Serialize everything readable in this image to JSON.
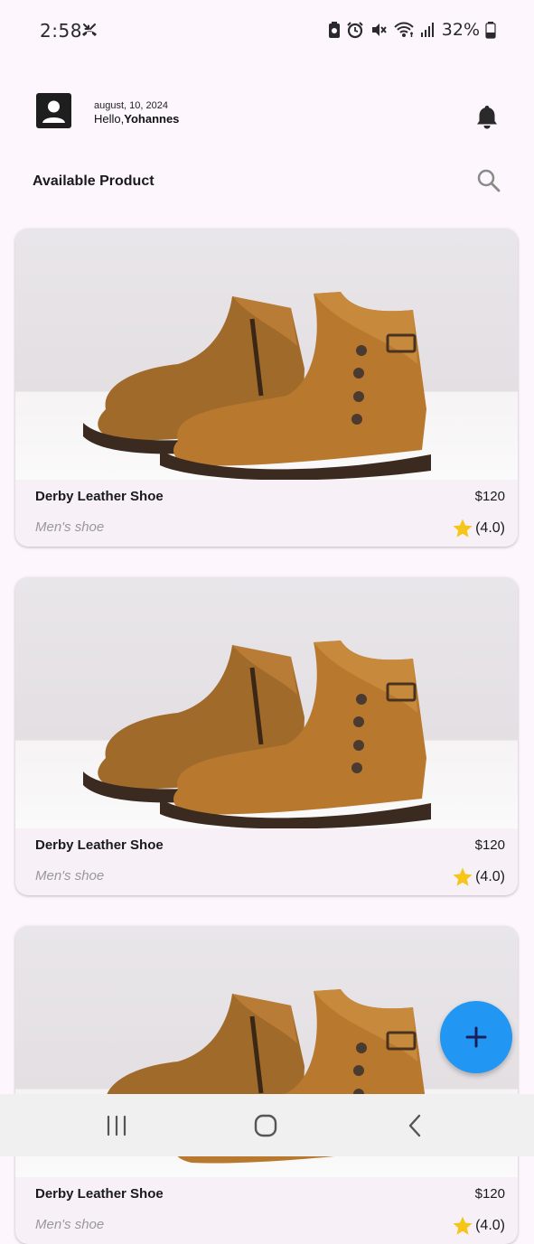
{
  "status_bar": {
    "time": "2:58",
    "battery": "32%"
  },
  "header": {
    "date": "august, 10, 2024",
    "greeting_prefix": "Hello,",
    "user_name": "Yohannes"
  },
  "section": {
    "title": "Available Product"
  },
  "products": [
    {
      "name": "Derby Leather Shoe",
      "price": "$120",
      "category": "Men's shoe",
      "rating": "(4.0)"
    },
    {
      "name": "Derby Leather Shoe",
      "price": "$120",
      "category": "Men's shoe",
      "rating": "(4.0)"
    },
    {
      "name": "Derby Leather Shoe",
      "price": "$120",
      "category": "Men's shoe",
      "rating": "(4.0)"
    }
  ],
  "colors": {
    "accent": "#2196f3",
    "star": "#f5c518",
    "background": "#fdf7fd"
  },
  "icons": {
    "avatar": "person-icon",
    "notifications": "bell-icon",
    "search": "search-icon",
    "fab": "plus-icon"
  }
}
